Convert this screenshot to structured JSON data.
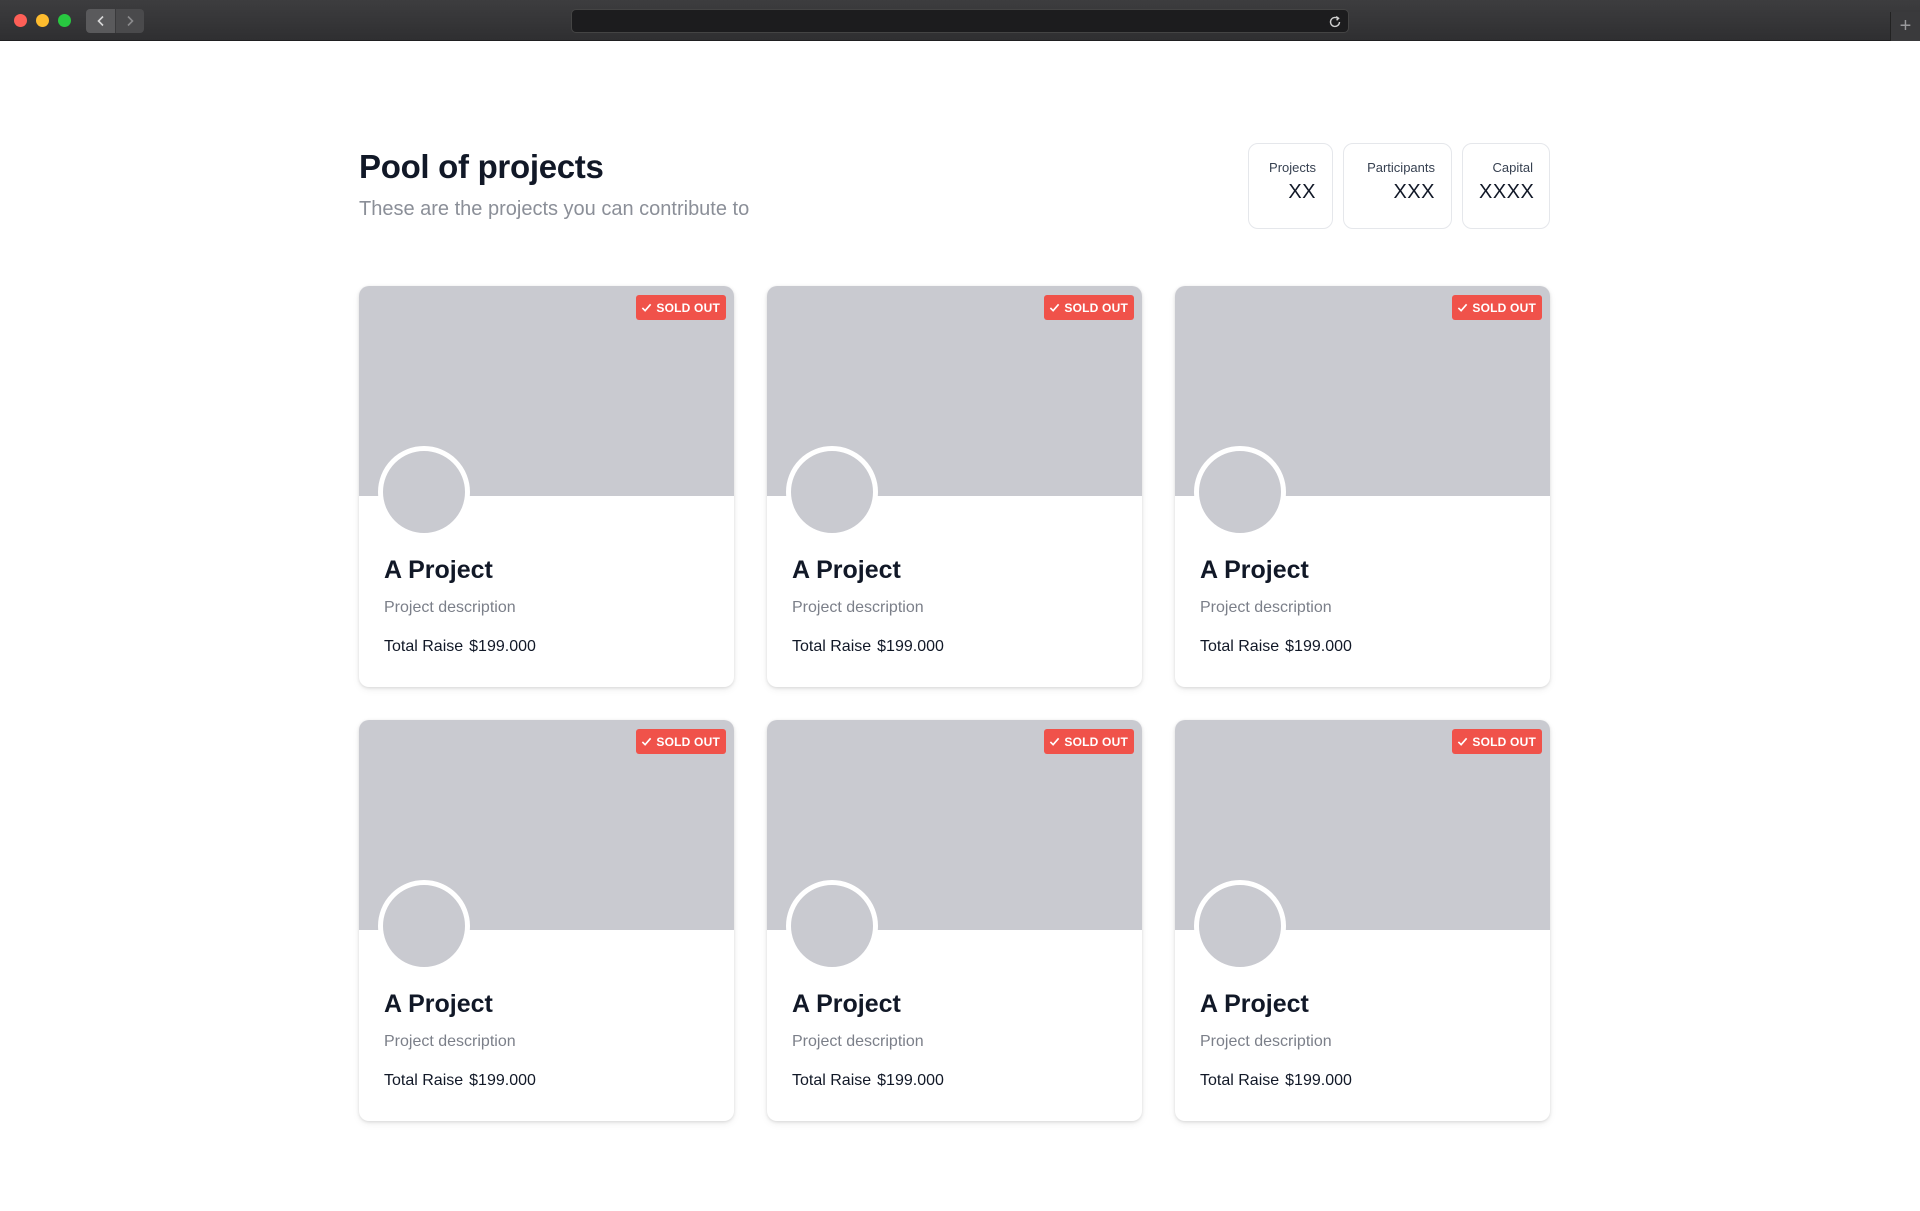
{
  "browser": {
    "url": "",
    "icons": {
      "back": "chevron-left-icon",
      "forward": "chevron-right-icon",
      "reload": "reload-icon",
      "new_tab": "plus-icon"
    },
    "new_tab_label": "+"
  },
  "header": {
    "title": "Pool of projects",
    "subtitle": "These are the projects you can contribute to"
  },
  "stats": [
    {
      "label": "Projects",
      "value": "XX"
    },
    {
      "label": "Participants",
      "value": "XXX"
    },
    {
      "label": "Capital",
      "value": "XXXX"
    }
  ],
  "colors": {
    "badge": "#f0524a",
    "cover_placeholder": "#c9cad0"
  },
  "projects": [
    {
      "badge": "SOLD OUT",
      "title": "A Project",
      "description": "Project description",
      "raise_label": "Total Raise",
      "raise_value": "$199.000"
    },
    {
      "badge": "SOLD OUT",
      "title": "A Project",
      "description": "Project description",
      "raise_label": "Total Raise",
      "raise_value": "$199.000"
    },
    {
      "badge": "SOLD OUT",
      "title": "A Project",
      "description": "Project description",
      "raise_label": "Total Raise",
      "raise_value": "$199.000"
    },
    {
      "badge": "SOLD OUT",
      "title": "A Project",
      "description": "Project description",
      "raise_label": "Total Raise",
      "raise_value": "$199.000"
    },
    {
      "badge": "SOLD OUT",
      "title": "A Project",
      "description": "Project description",
      "raise_label": "Total Raise",
      "raise_value": "$199.000"
    },
    {
      "badge": "SOLD OUT",
      "title": "A Project",
      "description": "Project description",
      "raise_label": "Total Raise",
      "raise_value": "$199.000"
    }
  ]
}
